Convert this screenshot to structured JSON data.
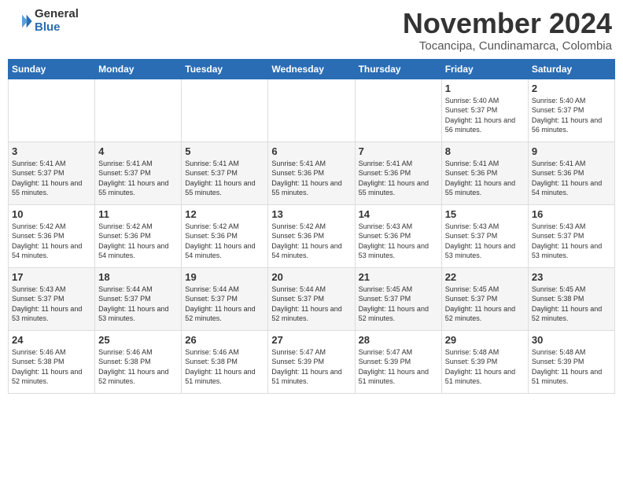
{
  "header": {
    "logo_general": "General",
    "logo_blue": "Blue",
    "month_title": "November 2024",
    "location": "Tocancipa, Cundinamarca, Colombia"
  },
  "days_of_week": [
    "Sunday",
    "Monday",
    "Tuesday",
    "Wednesday",
    "Thursday",
    "Friday",
    "Saturday"
  ],
  "weeks": [
    [
      {
        "day": "",
        "info": ""
      },
      {
        "day": "",
        "info": ""
      },
      {
        "day": "",
        "info": ""
      },
      {
        "day": "",
        "info": ""
      },
      {
        "day": "",
        "info": ""
      },
      {
        "day": "1",
        "info": "Sunrise: 5:40 AM\nSunset: 5:37 PM\nDaylight: 11 hours and 56 minutes."
      },
      {
        "day": "2",
        "info": "Sunrise: 5:40 AM\nSunset: 5:37 PM\nDaylight: 11 hours and 56 minutes."
      }
    ],
    [
      {
        "day": "3",
        "info": "Sunrise: 5:41 AM\nSunset: 5:37 PM\nDaylight: 11 hours and 55 minutes."
      },
      {
        "day": "4",
        "info": "Sunrise: 5:41 AM\nSunset: 5:37 PM\nDaylight: 11 hours and 55 minutes."
      },
      {
        "day": "5",
        "info": "Sunrise: 5:41 AM\nSunset: 5:37 PM\nDaylight: 11 hours and 55 minutes."
      },
      {
        "day": "6",
        "info": "Sunrise: 5:41 AM\nSunset: 5:36 PM\nDaylight: 11 hours and 55 minutes."
      },
      {
        "day": "7",
        "info": "Sunrise: 5:41 AM\nSunset: 5:36 PM\nDaylight: 11 hours and 55 minutes."
      },
      {
        "day": "8",
        "info": "Sunrise: 5:41 AM\nSunset: 5:36 PM\nDaylight: 11 hours and 55 minutes."
      },
      {
        "day": "9",
        "info": "Sunrise: 5:41 AM\nSunset: 5:36 PM\nDaylight: 11 hours and 54 minutes."
      }
    ],
    [
      {
        "day": "10",
        "info": "Sunrise: 5:42 AM\nSunset: 5:36 PM\nDaylight: 11 hours and 54 minutes."
      },
      {
        "day": "11",
        "info": "Sunrise: 5:42 AM\nSunset: 5:36 PM\nDaylight: 11 hours and 54 minutes."
      },
      {
        "day": "12",
        "info": "Sunrise: 5:42 AM\nSunset: 5:36 PM\nDaylight: 11 hours and 54 minutes."
      },
      {
        "day": "13",
        "info": "Sunrise: 5:42 AM\nSunset: 5:36 PM\nDaylight: 11 hours and 54 minutes."
      },
      {
        "day": "14",
        "info": "Sunrise: 5:43 AM\nSunset: 5:36 PM\nDaylight: 11 hours and 53 minutes."
      },
      {
        "day": "15",
        "info": "Sunrise: 5:43 AM\nSunset: 5:37 PM\nDaylight: 11 hours and 53 minutes."
      },
      {
        "day": "16",
        "info": "Sunrise: 5:43 AM\nSunset: 5:37 PM\nDaylight: 11 hours and 53 minutes."
      }
    ],
    [
      {
        "day": "17",
        "info": "Sunrise: 5:43 AM\nSunset: 5:37 PM\nDaylight: 11 hours and 53 minutes."
      },
      {
        "day": "18",
        "info": "Sunrise: 5:44 AM\nSunset: 5:37 PM\nDaylight: 11 hours and 53 minutes."
      },
      {
        "day": "19",
        "info": "Sunrise: 5:44 AM\nSunset: 5:37 PM\nDaylight: 11 hours and 52 minutes."
      },
      {
        "day": "20",
        "info": "Sunrise: 5:44 AM\nSunset: 5:37 PM\nDaylight: 11 hours and 52 minutes."
      },
      {
        "day": "21",
        "info": "Sunrise: 5:45 AM\nSunset: 5:37 PM\nDaylight: 11 hours and 52 minutes."
      },
      {
        "day": "22",
        "info": "Sunrise: 5:45 AM\nSunset: 5:37 PM\nDaylight: 11 hours and 52 minutes."
      },
      {
        "day": "23",
        "info": "Sunrise: 5:45 AM\nSunset: 5:38 PM\nDaylight: 11 hours and 52 minutes."
      }
    ],
    [
      {
        "day": "24",
        "info": "Sunrise: 5:46 AM\nSunset: 5:38 PM\nDaylight: 11 hours and 52 minutes."
      },
      {
        "day": "25",
        "info": "Sunrise: 5:46 AM\nSunset: 5:38 PM\nDaylight: 11 hours and 52 minutes."
      },
      {
        "day": "26",
        "info": "Sunrise: 5:46 AM\nSunset: 5:38 PM\nDaylight: 11 hours and 51 minutes."
      },
      {
        "day": "27",
        "info": "Sunrise: 5:47 AM\nSunset: 5:39 PM\nDaylight: 11 hours and 51 minutes."
      },
      {
        "day": "28",
        "info": "Sunrise: 5:47 AM\nSunset: 5:39 PM\nDaylight: 11 hours and 51 minutes."
      },
      {
        "day": "29",
        "info": "Sunrise: 5:48 AM\nSunset: 5:39 PM\nDaylight: 11 hours and 51 minutes."
      },
      {
        "day": "30",
        "info": "Sunrise: 5:48 AM\nSunset: 5:39 PM\nDaylight: 11 hours and 51 minutes."
      }
    ]
  ]
}
